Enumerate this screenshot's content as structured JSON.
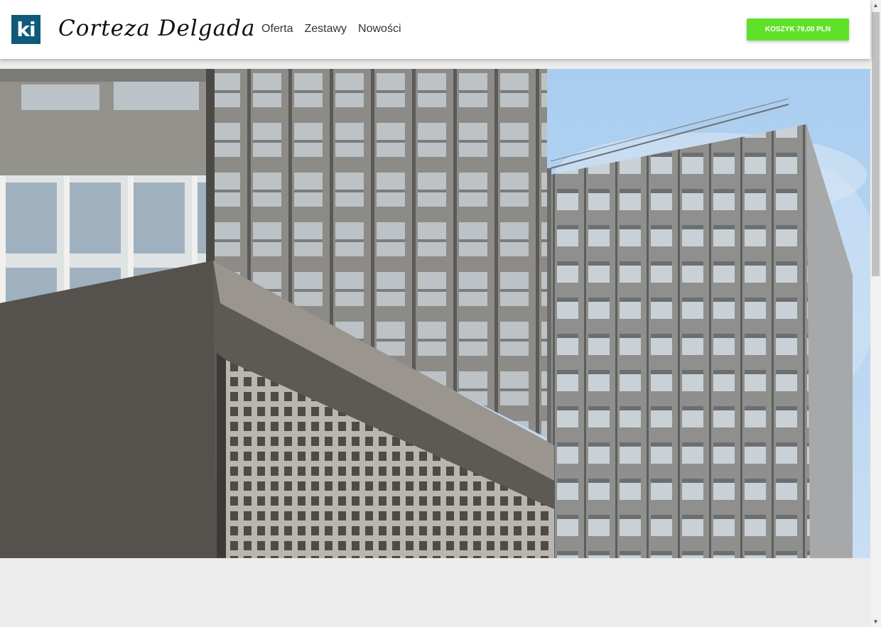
{
  "header": {
    "logo_text": "ki",
    "brand_name": "Corteza Delgada",
    "nav": [
      {
        "label": "Oferta"
      },
      {
        "label": "Zestawy"
      },
      {
        "label": "Nowości"
      }
    ],
    "cart_label": "KOSZYK 79,00 PLN"
  },
  "hero": {
    "image_subject": "modernist concrete office buildings against a blue sky"
  },
  "scrollbar": {
    "up_icon": "▲",
    "down_icon": "▼"
  },
  "colors": {
    "accent_green": "#5fe12a",
    "logo_blue": "#0f5a78",
    "page_background": "#ececec"
  }
}
